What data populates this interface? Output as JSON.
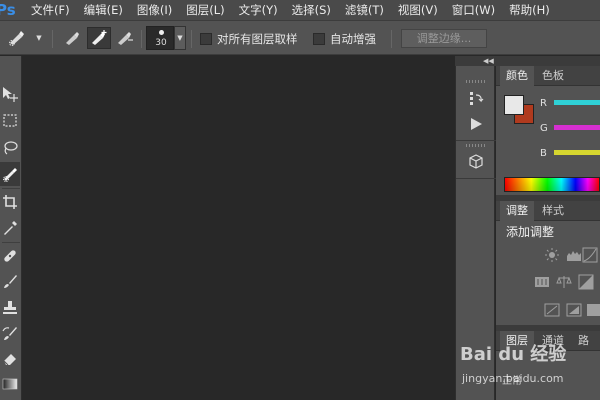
{
  "app": {
    "logo": "Ps"
  },
  "menu": {
    "items": [
      "文件(F)",
      "编辑(E)",
      "图像(I)",
      "图层(L)",
      "文字(Y)",
      "选择(S)",
      "滤镜(T)",
      "视图(V)",
      "窗口(W)",
      "帮助(H)"
    ]
  },
  "options": {
    "brush_size": "30",
    "sample_all_layers_label": "对所有图层取样",
    "sample_all_layers_checked": false,
    "auto_enhance_label": "自动增强",
    "auto_enhance_checked": false,
    "refine_edge_label": "调整边缘..."
  },
  "panels": {
    "color": {
      "tabs": [
        "颜色",
        "色板"
      ],
      "active_tab": "颜色",
      "foreground": "#e8e8e8",
      "background": "#b03a1e",
      "channels": [
        {
          "label": "R",
          "color": "#2fd1d6"
        },
        {
          "label": "G",
          "color": "#d62fd1"
        },
        {
          "label": "B",
          "color": "#d6d62f"
        }
      ]
    },
    "adjustments": {
      "tabs": [
        "调整",
        "样式"
      ],
      "active_tab": "调整",
      "title": "添加调整"
    },
    "layers": {
      "tabs": [
        "图层",
        "通道",
        "路径"
      ],
      "active_tab": "图层",
      "blend_mode": "正常"
    }
  },
  "watermark": {
    "brand": "Bai du 经验",
    "url": "jingyan.baidu.com"
  }
}
